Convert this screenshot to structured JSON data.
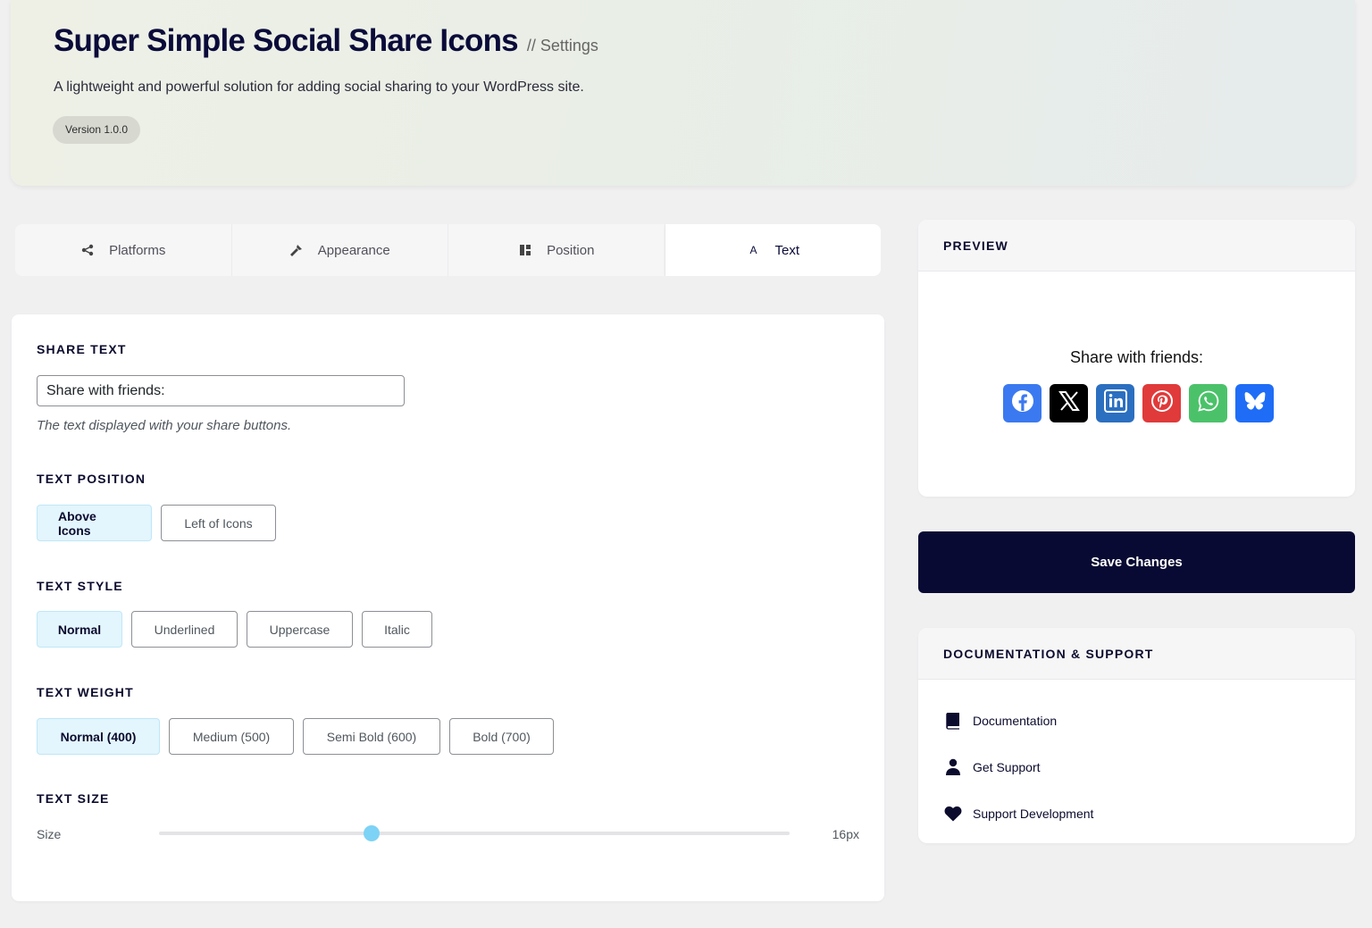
{
  "header": {
    "title": "Super Simple Social Share Icons",
    "subtitle": "// Settings",
    "description": "A lightweight and powerful solution for adding social sharing to your WordPress site.",
    "version": "Version 1.0.0"
  },
  "tabs": [
    {
      "label": "Platforms",
      "icon": "share-icon",
      "active": false
    },
    {
      "label": "Appearance",
      "icon": "paintbrush-icon",
      "active": false
    },
    {
      "label": "Position",
      "icon": "layout-icon",
      "active": false
    },
    {
      "label": "Text",
      "icon": "text-icon",
      "active": true
    }
  ],
  "text_tab": {
    "share_text": {
      "label": "SHARE TEXT",
      "value": "Share with friends:",
      "help": "The text displayed with your share buttons."
    },
    "text_position": {
      "label": "TEXT POSITION",
      "options": [
        "Above Icons",
        "Left of Icons"
      ],
      "selected": "Above Icons"
    },
    "text_style": {
      "label": "TEXT STYLE",
      "options": [
        "Normal",
        "Underlined",
        "Uppercase",
        "Italic"
      ],
      "selected": "Normal"
    },
    "text_weight": {
      "label": "TEXT WEIGHT",
      "options": [
        "Normal (400)",
        "Medium (500)",
        "Semi Bold (600)",
        "Bold (700)"
      ],
      "selected": "Normal (400)"
    },
    "text_size": {
      "label": "TEXT SIZE",
      "size_label": "Size",
      "value_text": "16px",
      "slider_fraction": 0.337
    }
  },
  "preview": {
    "heading": "PREVIEW",
    "share_text": "Share with friends:",
    "buttons": [
      {
        "name": "facebook",
        "icon": "facebook-icon",
        "color": "#1877f2"
      },
      {
        "name": "x",
        "icon": "x-icon",
        "color": "#000000"
      },
      {
        "name": "linkedin",
        "icon": "linkedin-icon",
        "color": "#0a66c2"
      },
      {
        "name": "pinterest",
        "icon": "pinterest-icon",
        "color": "#e60023"
      },
      {
        "name": "whatsapp",
        "icon": "whatsapp-icon",
        "color": "#25d366"
      },
      {
        "name": "bluesky",
        "icon": "bluesky-icon",
        "color": "#0085ff"
      }
    ]
  },
  "save_button": "Save Changes",
  "docs": {
    "heading": "DOCUMENTATION & SUPPORT",
    "items": [
      {
        "label": "Documentation",
        "icon": "book-icon"
      },
      {
        "label": "Get Support",
        "icon": "person-icon"
      },
      {
        "label": "Support Development",
        "icon": "heart-icon"
      }
    ]
  },
  "colors": {
    "accent_selected_bg": "#e3f5fd",
    "slider_thumb": "#7dd3f5",
    "navy": "#090a33"
  }
}
